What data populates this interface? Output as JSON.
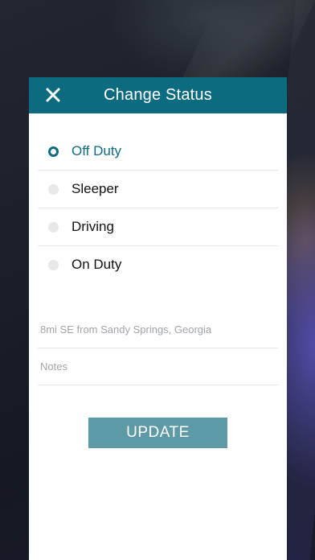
{
  "modal": {
    "title": "Change Status"
  },
  "statuses": [
    {
      "label": "Off Duty",
      "selected": true
    },
    {
      "label": "Sleeper",
      "selected": false
    },
    {
      "label": "Driving",
      "selected": false
    },
    {
      "label": "On Duty",
      "selected": false
    }
  ],
  "location": {
    "value": "8mi SE from Sandy Springs, Georgia"
  },
  "notes": {
    "placeholder": "Notes"
  },
  "actions": {
    "update_label": "UPDATE"
  },
  "colors": {
    "header": "#0d6b80",
    "accent": "#0d6b80",
    "button": "#5d9aa6"
  },
  "icons": {
    "close": "close-icon"
  }
}
